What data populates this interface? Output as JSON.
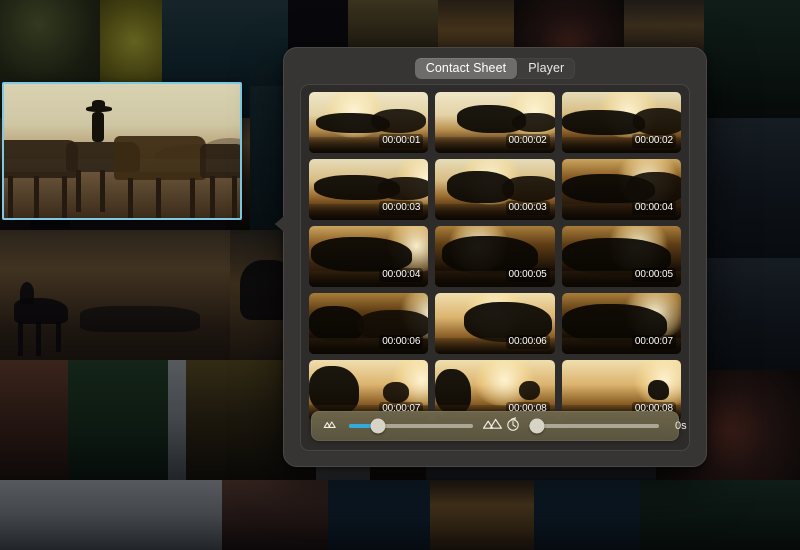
{
  "window": {
    "background_description": "dimmed photo collage wallpaper"
  },
  "preview": {
    "name": "selected-media-preview",
    "selection_color": "#7fc9e2",
    "alt": "cowboy riding horse with herd at sunset"
  },
  "panel": {
    "tabs": [
      {
        "label": "Contact Sheet",
        "active": true
      },
      {
        "label": "Player",
        "active": false
      }
    ]
  },
  "contact_sheet": {
    "thumbnails": [
      {
        "timestamp": "00:00:01",
        "scene": "sc-bright"
      },
      {
        "timestamp": "00:00:02",
        "scene": "sc-bright"
      },
      {
        "timestamp": "00:00:02",
        "scene": "sc-mid"
      },
      {
        "timestamp": "00:00:03",
        "scene": "sc-mid"
      },
      {
        "timestamp": "00:00:03",
        "scene": "sc-mid"
      },
      {
        "timestamp": "00:00:04",
        "scene": "sc-dark"
      },
      {
        "timestamp": "00:00:04",
        "scene": "sc-dark"
      },
      {
        "timestamp": "00:00:05",
        "scene": "sc-night"
      },
      {
        "timestamp": "00:00:05",
        "scene": "sc-night"
      },
      {
        "timestamp": "00:00:06",
        "scene": "sc-night"
      },
      {
        "timestamp": "00:00:06",
        "scene": "sc-dust"
      },
      {
        "timestamp": "00:00:07",
        "scene": "sc-night"
      },
      {
        "timestamp": "00:00:07",
        "scene": "sc-dust"
      },
      {
        "timestamp": "00:00:08",
        "scene": "sc-dust"
      },
      {
        "timestamp": "00:00:08",
        "scene": "sc-dust"
      }
    ]
  },
  "toolbar": {
    "thumbnail_size": {
      "small_icon": "mountains-small-icon",
      "large_icon": "mountains-large-icon",
      "fill_percent": 23,
      "knob_percent": 23,
      "accent_color": "#34aadc"
    },
    "duration": {
      "timer_icon": "stopwatch-icon",
      "knob_percent": 6,
      "value": "0s"
    }
  }
}
